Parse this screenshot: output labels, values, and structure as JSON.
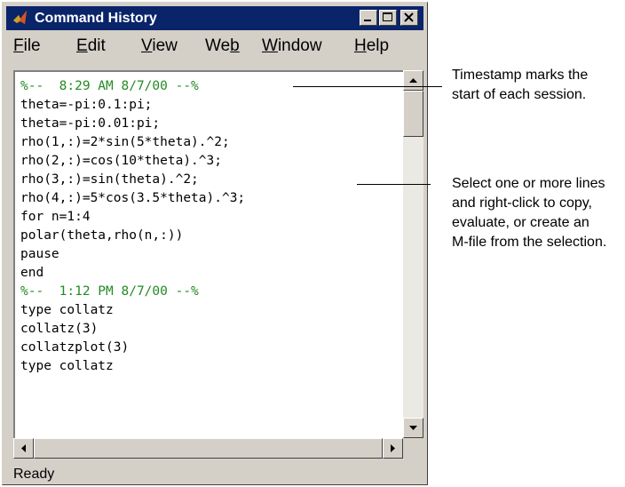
{
  "window": {
    "title": "Command History",
    "menu": [
      {
        "pre": "",
        "u": "F",
        "post": "ile"
      },
      {
        "pre": "",
        "u": "E",
        "post": "dit"
      },
      {
        "pre": "",
        "u": "V",
        "post": "iew"
      },
      {
        "pre": "We",
        "u": "b",
        "post": ""
      },
      {
        "pre": "",
        "u": "W",
        "post": "indow"
      },
      {
        "pre": "",
        "u": "H",
        "post": "elp"
      }
    ],
    "status": "Ready"
  },
  "history": [
    "%--  8:29 AM 8/7/00 --%",
    "theta=-pi:0.1:pi;",
    "theta=-pi:0.01:pi;",
    "rho(1,:)=2*sin(5*theta).^2;",
    "rho(2,:)=cos(10*theta).^3;",
    "rho(3,:)=sin(theta).^2;",
    "rho(4,:)=5*cos(3.5*theta).^3;",
    "for n=1:4",
    "polar(theta,rho(n,:))",
    "pause",
    "end",
    "%--  1:12 PM 8/7/00 --%",
    "type collatz",
    "collatz(3)",
    "collatzplot(3)",
    "type collatz"
  ],
  "callouts": {
    "timestamp": "Timestamp marks the\nstart of each session.",
    "select": "Select one or more lines\nand right-click to copy,\nevaluate, or create an\nM-file from the selection."
  },
  "colors": {
    "titlebar": "#0a246a",
    "timestamp_text": "#228b22"
  }
}
